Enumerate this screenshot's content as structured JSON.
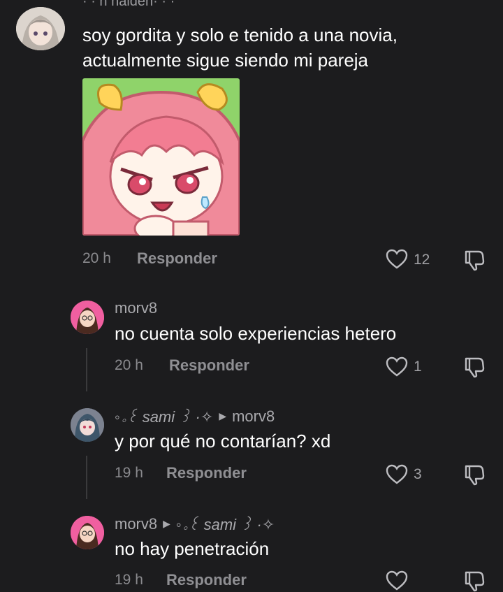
{
  "main_comment": {
    "username": "· · n haiden· · ·",
    "text_line1": "soy gordita y solo e tenido a una novia,",
    "text_line2": "actualmente sigue siendo mi pareja",
    "time": "20 h",
    "reply_label": "Responder",
    "likes": "12",
    "attachment_icon": "anime-sticker"
  },
  "replies": [
    {
      "username": "morv8",
      "reply_to": "",
      "text": "no cuenta solo experiencias hetero",
      "time": "20 h",
      "reply_label": "Responder",
      "likes": "1"
    },
    {
      "username": "◦｡꒰ sami ꒱ ·✧",
      "reply_to": "morv8",
      "text": "y por qué no contarían? xd",
      "time": "19 h",
      "reply_label": "Responder",
      "likes": "3"
    },
    {
      "username": "morv8",
      "reply_to": "◦｡꒰ sami ꒱ ·✧",
      "text": "no hay penetración",
      "time": "19 h",
      "reply_label": "Responder",
      "likes": ""
    }
  ],
  "colors": {
    "background": "#1c1c1e",
    "text": "#ffffff",
    "muted": "#8a8a8e",
    "sticker_bg": "#8fd36a",
    "hair": "#f08a9a"
  }
}
